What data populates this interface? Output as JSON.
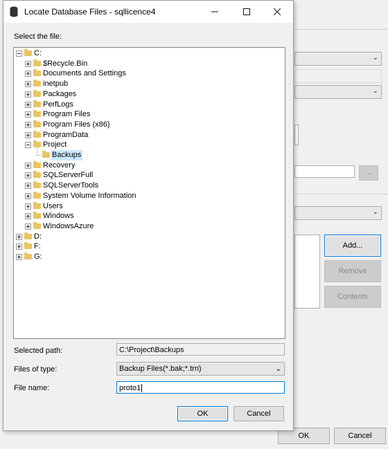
{
  "dialog": {
    "title": "Locate Database Files - sqllicence4",
    "select_file_label": "Select the file:",
    "selected_path_label": "Selected path:",
    "selected_path_value": "C:\\Project\\Backups",
    "files_of_type_label": "Files of type:",
    "files_of_type_value": "Backup Files(*.bak;*.trn)",
    "file_name_label": "File name:",
    "file_name_value": "proto1",
    "ok_label": "OK",
    "cancel_label": "Cancel"
  },
  "tree": [
    {
      "label": "C:",
      "expanded": true
    },
    {
      "label": "$Recycle.Bin"
    },
    {
      "label": "Documents and Settings"
    },
    {
      "label": "inetpub"
    },
    {
      "label": "Packages"
    },
    {
      "label": "PerfLogs"
    },
    {
      "label": "Program Files"
    },
    {
      "label": "Program Files (x86)"
    },
    {
      "label": "ProgramData"
    },
    {
      "label": "Project",
      "expanded": true
    },
    {
      "label": "Backups",
      "selected": true
    },
    {
      "label": "Recovery"
    },
    {
      "label": "SQLServerFull"
    },
    {
      "label": "SQLServerTools"
    },
    {
      "label": "System Volume Information"
    },
    {
      "label": "Users"
    },
    {
      "label": "Windows"
    },
    {
      "label": "WindowsAzure"
    },
    {
      "label": "D:"
    },
    {
      "label": "F:"
    },
    {
      "label": "G:"
    }
  ],
  "background": {
    "add_label": "Add...",
    "remove_label": "Remove",
    "contents_label": "Contents",
    "browse_label": "...",
    "ok_label": "OK",
    "cancel_label": "Cancel"
  },
  "colors": {
    "accent": "#0078d7",
    "folder": "#e8c560",
    "selection": "#cce8ff"
  }
}
